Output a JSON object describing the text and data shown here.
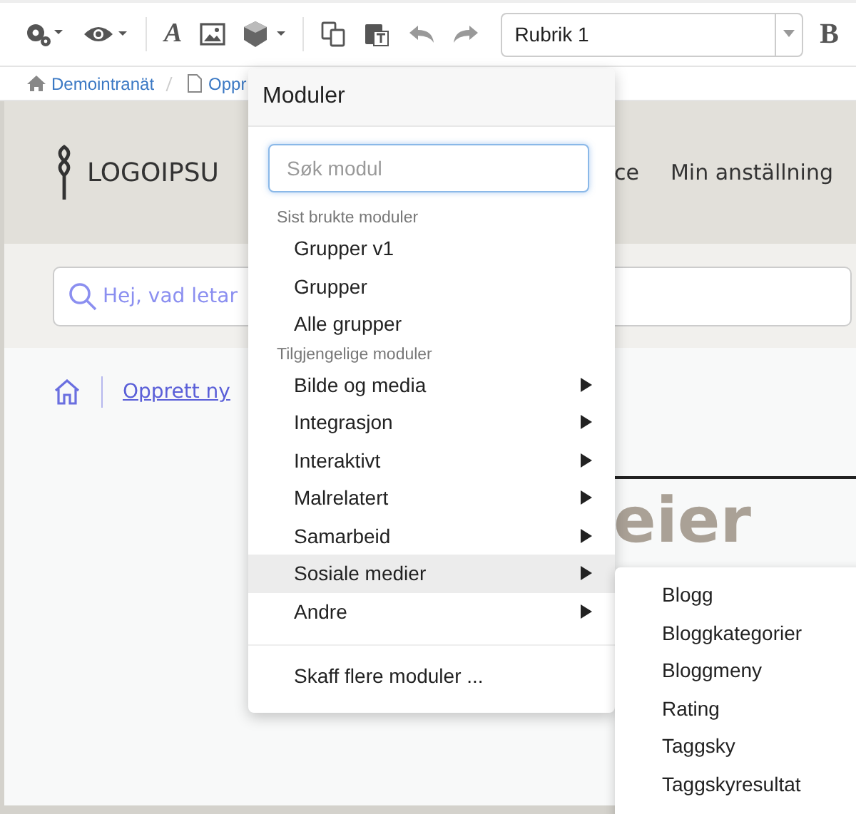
{
  "toolbar": {
    "font_label": "A",
    "format_select": {
      "value": "Rubrik 1"
    },
    "bold_label": "B"
  },
  "breadcrumb": [
    {
      "kind": "home",
      "label": "Demointranät"
    },
    {
      "kind": "page",
      "label": "Oppr"
    }
  ],
  "page": {
    "logo_text": "LOGOIPSU",
    "nav": [
      "ce",
      "Min anställning"
    ],
    "search": {
      "placeholder": "Hej, vad letar"
    },
    "links": [
      {
        "kind": "home"
      },
      {
        "kind": "link",
        "label": "Opprett ny"
      }
    ],
    "heading": "eier"
  },
  "menu": {
    "title": "Moduler",
    "search": {
      "placeholder": "Søk modul"
    },
    "sections": [
      {
        "heading": "Sist brukte moduler",
        "items": [
          {
            "label": "Grupper v1",
            "has_submenu": false,
            "selected": false
          },
          {
            "label": "Grupper",
            "has_submenu": false,
            "selected": false
          },
          {
            "label": "Alle grupper",
            "has_submenu": false,
            "selected": false
          }
        ]
      },
      {
        "heading": "Tilgjengelige moduler",
        "items": [
          {
            "label": "Bilde og media",
            "has_submenu": true,
            "selected": false
          },
          {
            "label": "Integrasjon",
            "has_submenu": true,
            "selected": false
          },
          {
            "label": "Interaktivt",
            "has_submenu": true,
            "selected": false
          },
          {
            "label": "Malrelatert",
            "has_submenu": true,
            "selected": false
          },
          {
            "label": "Samarbeid",
            "has_submenu": true,
            "selected": false
          },
          {
            "label": "Sosiale medier",
            "has_submenu": true,
            "selected": true
          },
          {
            "label": "Andre",
            "has_submenu": true,
            "selected": false
          }
        ]
      }
    ],
    "footer": "Skaff flere moduler ...",
    "submenu": [
      "Blogg",
      "Bloggkategorier",
      "Bloggmeny",
      "Rating",
      "Taggsky",
      "Taggskyresultat"
    ]
  }
}
